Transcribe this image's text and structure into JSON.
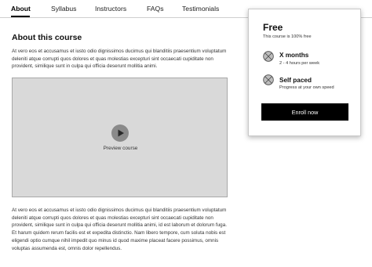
{
  "tabs": [
    {
      "label": "About",
      "active": true
    },
    {
      "label": "Syllabus",
      "active": false
    },
    {
      "label": "Instructors",
      "active": false
    },
    {
      "label": "FAQs",
      "active": false
    },
    {
      "label": "Testimonials",
      "active": false
    }
  ],
  "main": {
    "title": "About this course",
    "intro": "At vero eos et accusamus et iusto odio dignissimos ducimus qui blanditiis praesentium voluptatum deleniti atque corrupti quos dolores et quas molestias excepturi sint occaecati cupiditate non provident, similique sunt in culpa qui officia deserunt mollitia animi.",
    "video": {
      "play_icon": "play-icon",
      "label": "Preview course"
    },
    "body": "At vero eos et accusamus et iusto odio dignissimos ducimus qui blanditiis praesentium voluptatum deleniti atque corrupti quos dolores et quas molestias excepturi sint occaecati cupiditate non provident, similique sunt in culpa qui officia deserunt mollitia animi, id est laborum et dolorum fuga. Et harum quidem rerum facilis est et expedita distinctio. Nam libero tempore, cum soluta nobis est eligendi optio cumque nihil impedit quo minus id quod maxime placeat facere possimus, omnis voluptas assumenda est, omnis dolor repellendus."
  },
  "card": {
    "price": "Free",
    "price_note": "This course is 100% free",
    "features": [
      {
        "icon": "placeholder-icon",
        "title": "X months",
        "subtitle": "2 - 4 hours per week"
      },
      {
        "icon": "placeholder-icon",
        "title": "Self paced",
        "subtitle": "Progress at your own speed"
      }
    ],
    "enroll_label": "Enroll now"
  },
  "colors": {
    "accent": "#000000",
    "video_bg": "#d9d9d9",
    "play_button": "#8a8a8a"
  }
}
